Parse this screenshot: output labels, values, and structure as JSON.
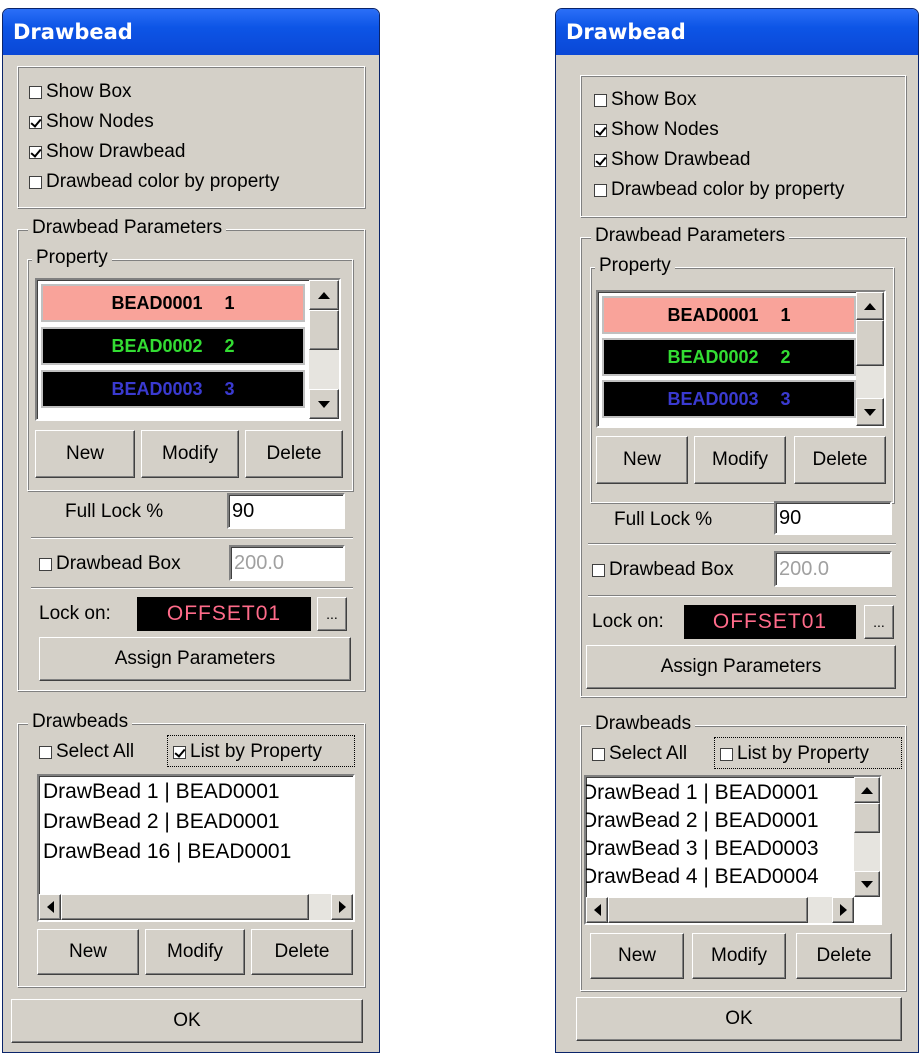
{
  "windows": [
    {
      "title": "Drawbead",
      "display": {
        "show_box": {
          "label": "Show Box",
          "checked": false
        },
        "show_nodes": {
          "label": "Show Nodes",
          "checked": true
        },
        "show_drawbead": {
          "label": "Show Drawbead",
          "checked": true
        },
        "color_by_property": {
          "label": "Drawbead color by property",
          "checked": false
        }
      },
      "params": {
        "legend": "Drawbead Parameters",
        "property_legend": "Property",
        "properties": [
          {
            "name": "BEAD0001",
            "id": "1",
            "bg": "#f9a39a",
            "fg": "#000000"
          },
          {
            "name": "BEAD0002",
            "id": "2",
            "bg": "#000000",
            "fg": "#33dd33"
          },
          {
            "name": "BEAD0003",
            "id": "3",
            "bg": "#000000",
            "fg": "#3a3ad0"
          }
        ],
        "new_label": "New",
        "modify_label": "Modify",
        "delete_label": "Delete",
        "full_lock_label": "Full Lock %",
        "full_lock_value": "90",
        "drawbead_box": {
          "label": "Drawbead Box",
          "checked": false,
          "value": "200.0"
        },
        "lock_on_label": "Lock on:",
        "lock_on_value": "OFFSET01",
        "browse_label": "...",
        "assign_label": "Assign Parameters"
      },
      "drawbeads": {
        "legend": "Drawbeads",
        "select_all": {
          "label": "Select All",
          "checked": false
        },
        "list_by_property": {
          "label": "List by Property",
          "checked": true
        },
        "items": [
          "DrawBead 1 | BEAD0001",
          "DrawBead 2 | BEAD0001",
          "DrawBead 16 | BEAD0001"
        ],
        "new_label": "New",
        "modify_label": "Modify",
        "delete_label": "Delete"
      },
      "ok_label": "OK"
    },
    {
      "title": "Drawbead",
      "display": {
        "show_box": {
          "label": "Show Box",
          "checked": false
        },
        "show_nodes": {
          "label": "Show Nodes",
          "checked": true
        },
        "show_drawbead": {
          "label": "Show Drawbead",
          "checked": true
        },
        "color_by_property": {
          "label": "Drawbead color by property",
          "checked": false
        }
      },
      "params": {
        "legend": "Drawbead Parameters",
        "property_legend": "Property",
        "properties": [
          {
            "name": "BEAD0001",
            "id": "1",
            "bg": "#f9a39a",
            "fg": "#000000"
          },
          {
            "name": "BEAD0002",
            "id": "2",
            "bg": "#000000",
            "fg": "#33dd33"
          },
          {
            "name": "BEAD0003",
            "id": "3",
            "bg": "#000000",
            "fg": "#3a3ad0"
          }
        ],
        "new_label": "New",
        "modify_label": "Modify",
        "delete_label": "Delete",
        "full_lock_label": "Full Lock %",
        "full_lock_value": "90",
        "drawbead_box": {
          "label": "Drawbead Box",
          "checked": false,
          "value": "200.0"
        },
        "lock_on_label": "Lock on:",
        "lock_on_value": "OFFSET01",
        "browse_label": "...",
        "assign_label": "Assign Parameters"
      },
      "drawbeads": {
        "legend": "Drawbeads",
        "select_all": {
          "label": "Select All",
          "checked": false
        },
        "list_by_property": {
          "label": "List by Property",
          "checked": false
        },
        "items": [
          "DrawBead 1 | BEAD0001",
          "DrawBead 2 | BEAD0001",
          "DrawBead 3 | BEAD0003",
          "DrawBead 4 | BEAD0004"
        ],
        "new_label": "New",
        "modify_label": "Modify",
        "delete_label": "Delete"
      },
      "ok_label": "OK"
    }
  ]
}
